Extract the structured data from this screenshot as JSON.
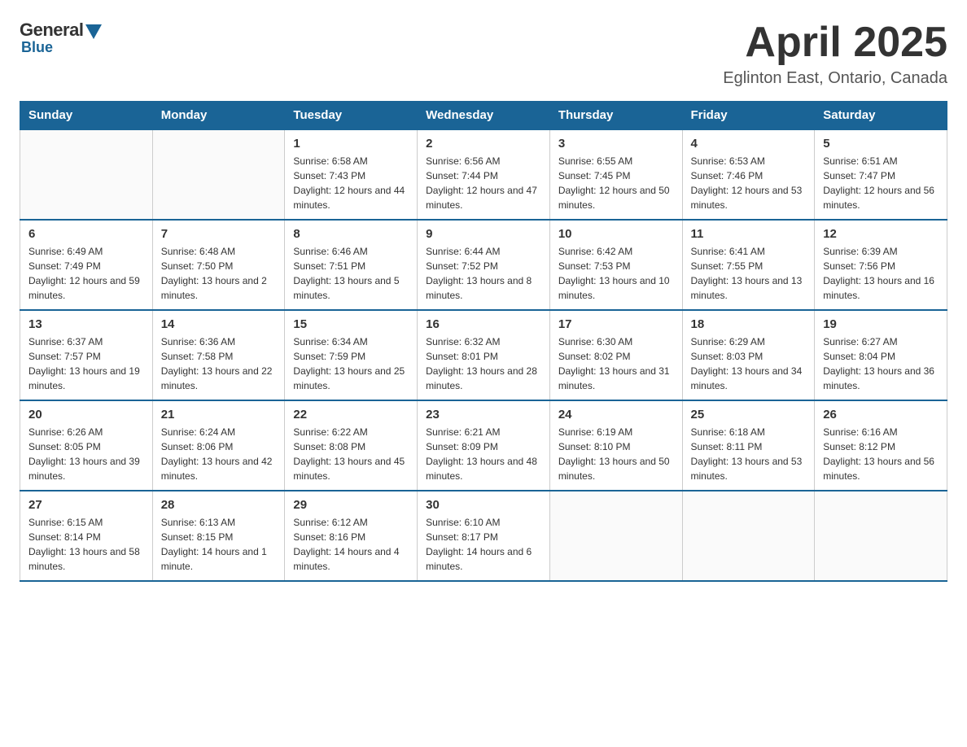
{
  "header": {
    "title": "April 2025",
    "location": "Eglinton East, Ontario, Canada",
    "logo": {
      "general": "General",
      "blue": "Blue"
    }
  },
  "days_of_week": [
    "Sunday",
    "Monday",
    "Tuesday",
    "Wednesday",
    "Thursday",
    "Friday",
    "Saturday"
  ],
  "weeks": [
    [
      {
        "day": "",
        "sunrise": "",
        "sunset": "",
        "daylight": ""
      },
      {
        "day": "",
        "sunrise": "",
        "sunset": "",
        "daylight": ""
      },
      {
        "day": "1",
        "sunrise": "Sunrise: 6:58 AM",
        "sunset": "Sunset: 7:43 PM",
        "daylight": "Daylight: 12 hours and 44 minutes."
      },
      {
        "day": "2",
        "sunrise": "Sunrise: 6:56 AM",
        "sunset": "Sunset: 7:44 PM",
        "daylight": "Daylight: 12 hours and 47 minutes."
      },
      {
        "day": "3",
        "sunrise": "Sunrise: 6:55 AM",
        "sunset": "Sunset: 7:45 PM",
        "daylight": "Daylight: 12 hours and 50 minutes."
      },
      {
        "day": "4",
        "sunrise": "Sunrise: 6:53 AM",
        "sunset": "Sunset: 7:46 PM",
        "daylight": "Daylight: 12 hours and 53 minutes."
      },
      {
        "day": "5",
        "sunrise": "Sunrise: 6:51 AM",
        "sunset": "Sunset: 7:47 PM",
        "daylight": "Daylight: 12 hours and 56 minutes."
      }
    ],
    [
      {
        "day": "6",
        "sunrise": "Sunrise: 6:49 AM",
        "sunset": "Sunset: 7:49 PM",
        "daylight": "Daylight: 12 hours and 59 minutes."
      },
      {
        "day": "7",
        "sunrise": "Sunrise: 6:48 AM",
        "sunset": "Sunset: 7:50 PM",
        "daylight": "Daylight: 13 hours and 2 minutes."
      },
      {
        "day": "8",
        "sunrise": "Sunrise: 6:46 AM",
        "sunset": "Sunset: 7:51 PM",
        "daylight": "Daylight: 13 hours and 5 minutes."
      },
      {
        "day": "9",
        "sunrise": "Sunrise: 6:44 AM",
        "sunset": "Sunset: 7:52 PM",
        "daylight": "Daylight: 13 hours and 8 minutes."
      },
      {
        "day": "10",
        "sunrise": "Sunrise: 6:42 AM",
        "sunset": "Sunset: 7:53 PM",
        "daylight": "Daylight: 13 hours and 10 minutes."
      },
      {
        "day": "11",
        "sunrise": "Sunrise: 6:41 AM",
        "sunset": "Sunset: 7:55 PM",
        "daylight": "Daylight: 13 hours and 13 minutes."
      },
      {
        "day": "12",
        "sunrise": "Sunrise: 6:39 AM",
        "sunset": "Sunset: 7:56 PM",
        "daylight": "Daylight: 13 hours and 16 minutes."
      }
    ],
    [
      {
        "day": "13",
        "sunrise": "Sunrise: 6:37 AM",
        "sunset": "Sunset: 7:57 PM",
        "daylight": "Daylight: 13 hours and 19 minutes."
      },
      {
        "day": "14",
        "sunrise": "Sunrise: 6:36 AM",
        "sunset": "Sunset: 7:58 PM",
        "daylight": "Daylight: 13 hours and 22 minutes."
      },
      {
        "day": "15",
        "sunrise": "Sunrise: 6:34 AM",
        "sunset": "Sunset: 7:59 PM",
        "daylight": "Daylight: 13 hours and 25 minutes."
      },
      {
        "day": "16",
        "sunrise": "Sunrise: 6:32 AM",
        "sunset": "Sunset: 8:01 PM",
        "daylight": "Daylight: 13 hours and 28 minutes."
      },
      {
        "day": "17",
        "sunrise": "Sunrise: 6:30 AM",
        "sunset": "Sunset: 8:02 PM",
        "daylight": "Daylight: 13 hours and 31 minutes."
      },
      {
        "day": "18",
        "sunrise": "Sunrise: 6:29 AM",
        "sunset": "Sunset: 8:03 PM",
        "daylight": "Daylight: 13 hours and 34 minutes."
      },
      {
        "day": "19",
        "sunrise": "Sunrise: 6:27 AM",
        "sunset": "Sunset: 8:04 PM",
        "daylight": "Daylight: 13 hours and 36 minutes."
      }
    ],
    [
      {
        "day": "20",
        "sunrise": "Sunrise: 6:26 AM",
        "sunset": "Sunset: 8:05 PM",
        "daylight": "Daylight: 13 hours and 39 minutes."
      },
      {
        "day": "21",
        "sunrise": "Sunrise: 6:24 AM",
        "sunset": "Sunset: 8:06 PM",
        "daylight": "Daylight: 13 hours and 42 minutes."
      },
      {
        "day": "22",
        "sunrise": "Sunrise: 6:22 AM",
        "sunset": "Sunset: 8:08 PM",
        "daylight": "Daylight: 13 hours and 45 minutes."
      },
      {
        "day": "23",
        "sunrise": "Sunrise: 6:21 AM",
        "sunset": "Sunset: 8:09 PM",
        "daylight": "Daylight: 13 hours and 48 minutes."
      },
      {
        "day": "24",
        "sunrise": "Sunrise: 6:19 AM",
        "sunset": "Sunset: 8:10 PM",
        "daylight": "Daylight: 13 hours and 50 minutes."
      },
      {
        "day": "25",
        "sunrise": "Sunrise: 6:18 AM",
        "sunset": "Sunset: 8:11 PM",
        "daylight": "Daylight: 13 hours and 53 minutes."
      },
      {
        "day": "26",
        "sunrise": "Sunrise: 6:16 AM",
        "sunset": "Sunset: 8:12 PM",
        "daylight": "Daylight: 13 hours and 56 minutes."
      }
    ],
    [
      {
        "day": "27",
        "sunrise": "Sunrise: 6:15 AM",
        "sunset": "Sunset: 8:14 PM",
        "daylight": "Daylight: 13 hours and 58 minutes."
      },
      {
        "day": "28",
        "sunrise": "Sunrise: 6:13 AM",
        "sunset": "Sunset: 8:15 PM",
        "daylight": "Daylight: 14 hours and 1 minute."
      },
      {
        "day": "29",
        "sunrise": "Sunrise: 6:12 AM",
        "sunset": "Sunset: 8:16 PM",
        "daylight": "Daylight: 14 hours and 4 minutes."
      },
      {
        "day": "30",
        "sunrise": "Sunrise: 6:10 AM",
        "sunset": "Sunset: 8:17 PM",
        "daylight": "Daylight: 14 hours and 6 minutes."
      },
      {
        "day": "",
        "sunrise": "",
        "sunset": "",
        "daylight": ""
      },
      {
        "day": "",
        "sunrise": "",
        "sunset": "",
        "daylight": ""
      },
      {
        "day": "",
        "sunrise": "",
        "sunset": "",
        "daylight": ""
      }
    ]
  ]
}
